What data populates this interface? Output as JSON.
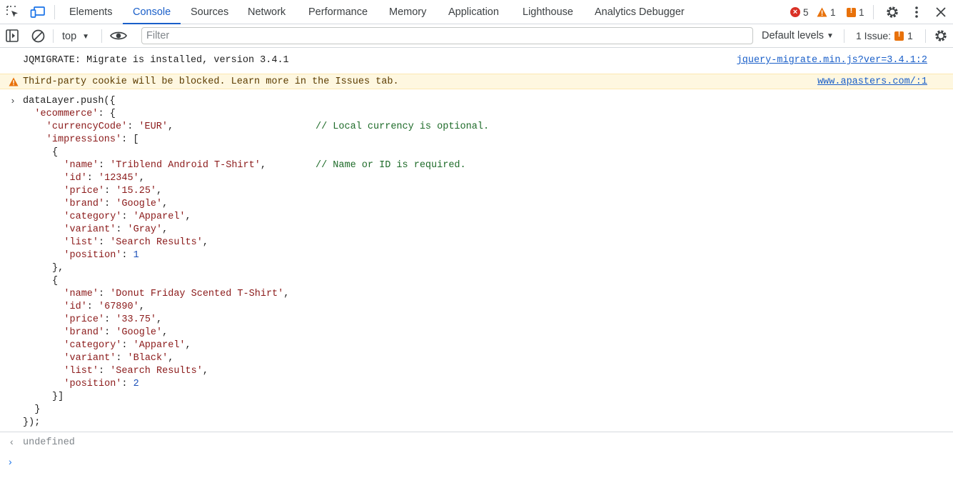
{
  "tabs": [
    {
      "label": "Elements",
      "active": false
    },
    {
      "label": "Console",
      "active": true
    },
    {
      "label": "Sources",
      "active": false
    },
    {
      "label": "Network",
      "active": false
    },
    {
      "label": "Performance",
      "active": false
    },
    {
      "label": "Memory",
      "active": false
    },
    {
      "label": "Application",
      "active": false
    },
    {
      "label": "Lighthouse",
      "active": false
    },
    {
      "label": "Analytics Debugger",
      "active": false
    }
  ],
  "counts": {
    "errors": "5",
    "warnings": "1",
    "issues": "1"
  },
  "toolbar": {
    "context": "top",
    "filter_placeholder": "Filter",
    "levels": "Default levels",
    "issues_label": "1 Issue:",
    "issues_count": "1"
  },
  "messages": {
    "info": {
      "text": "JQMIGRATE: Migrate is installed, version 3.4.1",
      "source": "jquery-migrate.min.js?ver=3.4.1:2"
    },
    "warning": {
      "text": "Third-party cookie will be blocked. Learn more in the Issues tab.",
      "source": "www.apasters.com/:1"
    }
  },
  "code": {
    "open": "dataLayer.push({",
    "ecommerce_key": "'ecommerce'",
    "currency_key": "'currencyCode'",
    "currency_value": "'EUR'",
    "currency_comment": "// Local currency is optional.",
    "impressions_key": "'impressions'",
    "name_comment": "// Name or ID is required.",
    "items": [
      {
        "fields": [
          {
            "key": "'name'",
            "value": "'Triblend Android T-Shirt'",
            "type": "string"
          },
          {
            "key": "'id'",
            "value": "'12345'",
            "type": "string"
          },
          {
            "key": "'price'",
            "value": "'15.25'",
            "type": "string"
          },
          {
            "key": "'brand'",
            "value": "'Google'",
            "type": "string"
          },
          {
            "key": "'category'",
            "value": "'Apparel'",
            "type": "string"
          },
          {
            "key": "'variant'",
            "value": "'Gray'",
            "type": "string"
          },
          {
            "key": "'list'",
            "value": "'Search Results'",
            "type": "string"
          },
          {
            "key": "'position'",
            "value": "1",
            "type": "number"
          }
        ]
      },
      {
        "fields": [
          {
            "key": "'name'",
            "value": "'Donut Friday Scented T-Shirt'",
            "type": "string"
          },
          {
            "key": "'id'",
            "value": "'67890'",
            "type": "string"
          },
          {
            "key": "'price'",
            "value": "'33.75'",
            "type": "string"
          },
          {
            "key": "'brand'",
            "value": "'Google'",
            "type": "string"
          },
          {
            "key": "'category'",
            "value": "'Apparel'",
            "type": "string"
          },
          {
            "key": "'variant'",
            "value": "'Black'",
            "type": "string"
          },
          {
            "key": "'list'",
            "value": "'Search Results'",
            "type": "string"
          },
          {
            "key": "'position'",
            "value": "2",
            "type": "number"
          }
        ]
      }
    ],
    "close": "});"
  },
  "result": "undefined",
  "colors": {
    "accent": "#1a5fc9",
    "error": "#d93025",
    "warning": "#e8710a",
    "string": "#8b1a1a",
    "number": "#1a4fb8",
    "comment": "#1e6b29"
  }
}
